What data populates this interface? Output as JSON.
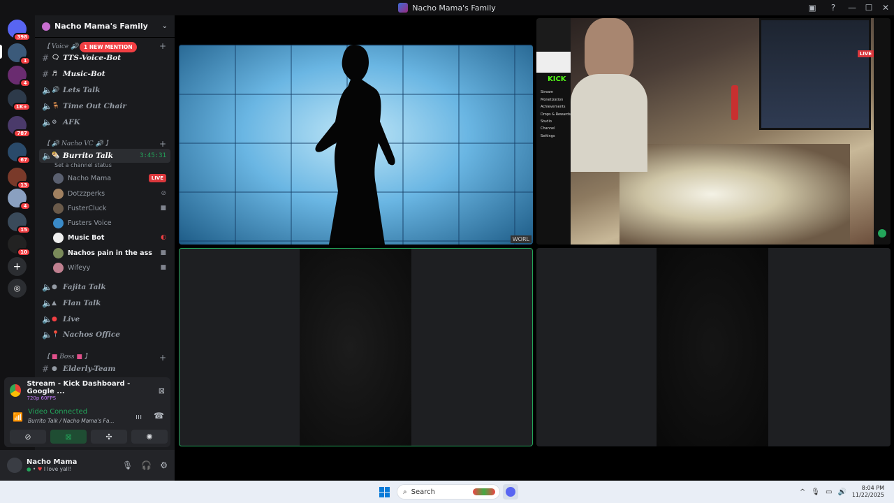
{
  "window": {
    "title": "Nacho Mama's Family"
  },
  "servers": {
    "badges": [
      "398",
      "1",
      "4",
      "1K+",
      "787",
      "67",
      "13",
      "4",
      "15",
      "10"
    ]
  },
  "guild": {
    "name": "Nacho Mama's Family"
  },
  "categories": {
    "voice": "Voice",
    "nacho_vc": "Nacho VC",
    "boss": "Boss"
  },
  "mention": "1 NEW MENTION",
  "channels": [
    {
      "name": "TTS-Voice-Bot"
    },
    {
      "name": "Music-Bot"
    },
    {
      "name": "Lets Talk"
    },
    {
      "name": "Time Out Chair"
    },
    {
      "name": "AFK"
    },
    {
      "name": "Burrito Talk",
      "time": "3:45:31",
      "status": "Set a channel status"
    },
    {
      "name": "Fajita Talk"
    },
    {
      "name": "Flan Talk"
    },
    {
      "name": "Live"
    },
    {
      "name": "Nachos Office"
    },
    {
      "name": "Elderly-Team"
    }
  ],
  "voice_users": [
    {
      "name": "Nacho Mama",
      "badge": "LIVE"
    },
    {
      "name": "Dotzzperks"
    },
    {
      "name": "FusterCluck"
    },
    {
      "name": "Fusters Voice"
    },
    {
      "name": "Music Bot"
    },
    {
      "name": "Nachos pain in the ass"
    },
    {
      "name": "Wifeyy"
    }
  ],
  "stream_panel": {
    "title": "Stream - Kick Dashboard - Google ...",
    "quality": "720p 60FPS"
  },
  "voice_panel": {
    "status": "Video Connected",
    "location": "Burrito Talk / Nacho Mama's Fa..."
  },
  "user_panel": {
    "name": "Nacho Mama",
    "status": "I love yall!"
  },
  "stage": {
    "watermark": "WORL",
    "kick_logo": "KICK",
    "kick_menu": [
      "Stream",
      "Monetization",
      "Achievements",
      "Drops & Rewards",
      "Studio",
      "Channel",
      "Settings"
    ],
    "live_badge": "LIVE"
  },
  "taskbar": {
    "search_placeholder": "Search",
    "time": "8:04 PM",
    "date": "11/22/2025"
  }
}
